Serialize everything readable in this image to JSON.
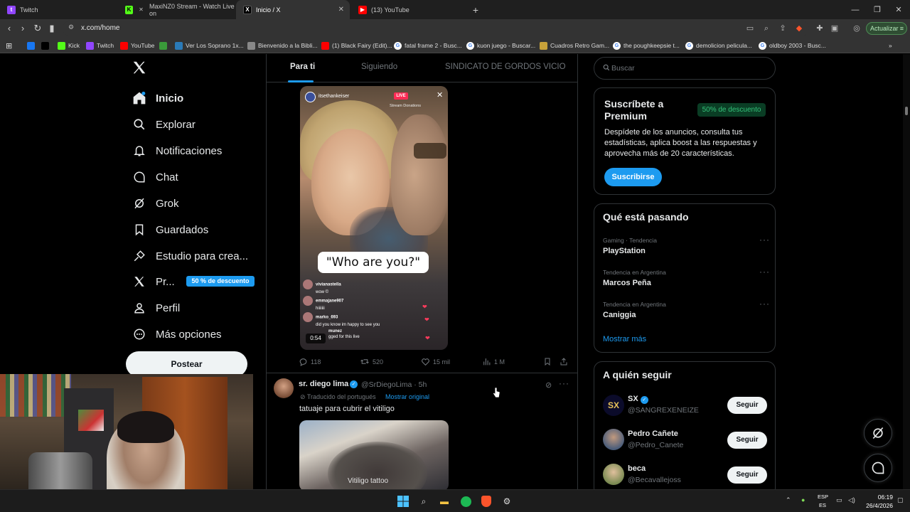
{
  "browser": {
    "tabs": [
      {
        "label": "Twitch",
        "icon": "twitch-icon",
        "active": false
      },
      {
        "label": "MaxiNZ0 Stream - Watch Live on",
        "icon": "kick-icon",
        "active": false
      },
      {
        "label": "Inicio / X",
        "icon": "x-icon",
        "active": true
      },
      {
        "label": "(13) YouTube",
        "icon": "youtube-icon",
        "active": false
      }
    ],
    "new_tab": "+",
    "url": "x.com/home",
    "update_label": "Actualizar",
    "bookmarks": [
      {
        "label": "",
        "icon": "facebook-icon",
        "color": "#1877f2"
      },
      {
        "label": "",
        "icon": "x-icon",
        "color": "#000000"
      },
      {
        "label": "Kick",
        "icon": "kick-icon",
        "color": "#53fc18"
      },
      {
        "label": "Twitch",
        "icon": "twitch-icon",
        "color": "#9146ff"
      },
      {
        "label": "YouTube",
        "icon": "youtube-icon",
        "color": "#ff0000"
      },
      {
        "label": "",
        "icon": "game-icon",
        "color": "#3a9a3a"
      },
      {
        "label": "Ver Los Soprano 1x...",
        "icon": "site-icon",
        "color": "#2a7ab8"
      },
      {
        "label": "Bienvenido a la Bibli...",
        "icon": "library-icon",
        "color": "#888888"
      },
      {
        "label": "(1) Black Fairy (Edit)...",
        "icon": "youtube-icon",
        "color": "#ff0000"
      },
      {
        "label": "fatal frame 2 - Busc...",
        "icon": "google-icon",
        "color": "#ffffff"
      },
      {
        "label": "kuon juego - Buscar...",
        "icon": "google-icon",
        "color": "#ffffff"
      },
      {
        "label": "Cuadros Retro Gam...",
        "icon": "retro-icon",
        "color": "#c8a23a"
      },
      {
        "label": "the poughkeepsie t...",
        "icon": "google-icon",
        "color": "#ffffff"
      },
      {
        "label": "demolicion pelicula...",
        "icon": "google-icon",
        "color": "#ffffff"
      },
      {
        "label": "oldboy 2003 - Busc...",
        "icon": "google-icon",
        "color": "#ffffff"
      }
    ]
  },
  "nav": {
    "items": [
      {
        "label": "Inicio",
        "icon": "home-icon",
        "active": true
      },
      {
        "label": "Explorar",
        "icon": "search-icon"
      },
      {
        "label": "Notificaciones",
        "icon": "bell-icon"
      },
      {
        "label": "Chat",
        "icon": "chat-icon"
      },
      {
        "label": "Grok",
        "icon": "grok-icon"
      },
      {
        "label": "Guardados",
        "icon": "bookmark-icon"
      },
      {
        "label": "Estudio para crea...",
        "icon": "studio-icon"
      },
      {
        "label": "Pr...",
        "icon": "x-premium-icon"
      },
      {
        "label": "Perfil",
        "icon": "profile-icon"
      },
      {
        "label": "Más opciones",
        "icon": "more-icon"
      }
    ],
    "premium_badge": "50 % de descuento",
    "post_button": "Postear"
  },
  "feed": {
    "tabs": [
      "Para ti",
      "Siguiendo",
      "SINDICATO DE GORDOS VICIO"
    ],
    "video": {
      "caption": "\"Who are you?\"",
      "user": "itsethankeiser",
      "live": "LIVE",
      "donations": "Stream Donations",
      "time": "0:54",
      "comments": [
        {
          "user": "vivianastella",
          "text": "wow ©"
        },
        {
          "user": "emmajane907",
          "text": "hiiiiiii"
        },
        {
          "user": "marko_693",
          "text": "did you know im happy to see you"
        },
        {
          "user": "munez",
          "text": "gged for this live"
        }
      ]
    },
    "actions": {
      "replies": "118",
      "reposts": "520",
      "likes": "15 mil",
      "views": "1 M"
    },
    "tweet2": {
      "name": "sr. diego lima",
      "handle": "@SrDiegoLima · 5h",
      "translated": "Traducido del portugués",
      "show_original": "Mostrar original",
      "text": "tatuaje para cubrir el vitiligo",
      "media_caption": "Vitiligo tattoo"
    }
  },
  "sidebar": {
    "search_placeholder": "Buscar",
    "premium": {
      "title": "Suscríbete a Premium",
      "discount": "50% de descuento",
      "description": "Despídete de los anuncios, consulta tus estadísticas, aplica boost a las respuestas y aprovecha más de 20 características.",
      "button": "Suscribirse"
    },
    "trends": {
      "title": "Qué está pasando",
      "items": [
        {
          "category": "Gaming · Tendencia",
          "name": "PlayStation"
        },
        {
          "category": "Tendencia en Argentina",
          "name": "Marcos Peña"
        },
        {
          "category": "Tendencia en Argentina",
          "name": "Caniggia"
        }
      ],
      "show_more": "Mostrar más"
    },
    "follow": {
      "title": "A quién seguir",
      "items": [
        {
          "name": "SX",
          "handle": "@SANGREXENEIZE",
          "button": "Seguir"
        },
        {
          "name": "Pedro Cañete",
          "handle": "@Pedro_Canete",
          "button": "Seguir"
        },
        {
          "name": "beca",
          "handle": "@Becavallejoss",
          "button": "Seguir"
        }
      ]
    }
  },
  "taskbar": {
    "lang1": "ESP",
    "lang2": "ES",
    "time": "06:19",
    "date": "26/4/2026"
  },
  "colors": {
    "accent": "#1d9bf0",
    "background": "#000000",
    "text": "#e7e9ea",
    "muted": "#71767b"
  }
}
